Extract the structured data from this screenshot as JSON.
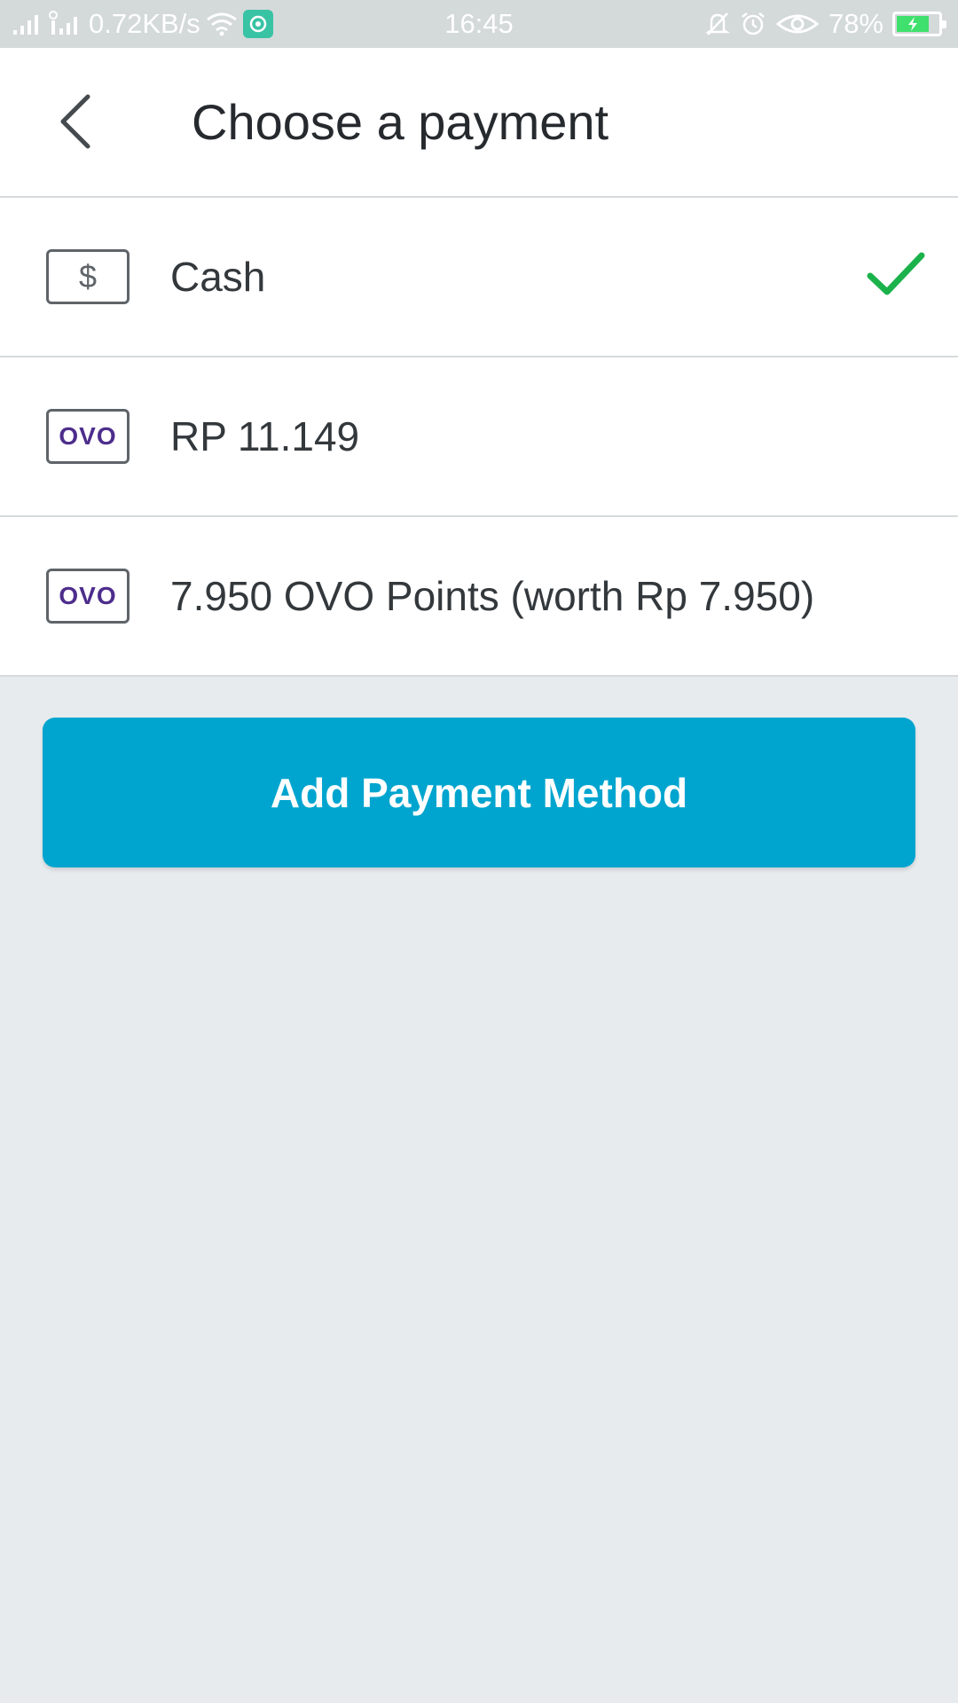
{
  "status_bar": {
    "network_speed": "0.72KB/s",
    "time": "16:45",
    "battery": "78%",
    "battery_level": 0.78,
    "icons": [
      "signal-icon",
      "signal-icon-2",
      "wifi-icon",
      "app-notification-icon",
      "bell-muted-icon",
      "alarm-icon",
      "eye-icon",
      "battery-charging-icon"
    ]
  },
  "header": {
    "back_icon": "chevron-left-icon",
    "title": "Choose a payment"
  },
  "payment_methods": [
    {
      "icon": "dollar-icon",
      "icon_text": "$",
      "label": "Cash",
      "selected": true
    },
    {
      "icon": "ovo-logo-icon",
      "icon_text": "OVO",
      "label": "RP 11.149",
      "selected": false
    },
    {
      "icon": "ovo-logo-icon",
      "icon_text": "OVO",
      "label": "7.950 OVO Points (worth Rp 7.950)",
      "selected": false
    }
  ],
  "add_button": {
    "label": "Add Payment Method"
  },
  "colors": {
    "accent": "#00a5cf",
    "check": "#1bb24b",
    "ovo_purple": "#4d2d8c",
    "background": "#e7ebee"
  }
}
